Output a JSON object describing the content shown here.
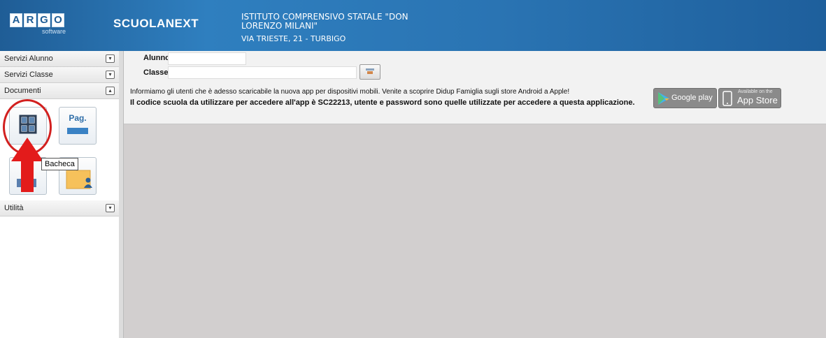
{
  "header": {
    "logo_letters": [
      "A",
      "R",
      "G",
      "O"
    ],
    "logo_subtitle": "software",
    "brand": "SCUOLANEXT",
    "school_name": "ISTITUTO COMPRENSIVO STATALE \"DON LORENZO MILANI\"",
    "school_address": "VIA TRIESTE, 21 - TURBIGO"
  },
  "sidebar": {
    "sections": [
      {
        "label": "Servizi Alunno",
        "toggle": "▾"
      },
      {
        "label": "Servizi Classe",
        "toggle": "▾"
      },
      {
        "label": "Documenti",
        "toggle": "▴"
      },
      {
        "label": "Utilità",
        "toggle": "▾"
      }
    ],
    "documenti_tiles": [
      {
        "name": "Bacheca",
        "icon": "grid-icon"
      },
      {
        "name": "Pag.",
        "icon": "pag-icon"
      },
      {
        "name": "",
        "icon": "doc-icon"
      },
      {
        "name": "",
        "icon": "folder-user-icon"
      }
    ],
    "tooltip": "Bacheca"
  },
  "form": {
    "alunno_label": "Alunno:",
    "alunno_value": "",
    "classe_label": "Classe:",
    "classe_value": ""
  },
  "info": {
    "line1": "Informiamo gli utenti che è adesso scaricabile la nuova app per dispositivi mobili. Venite a scoprire Didup Famiglia sugli store Android a Apple!",
    "line2": "Il codice scuola da utilizzare per accedere all'app è SC22213, utente e password sono quelle utilizzate per accedere a questa applicazione."
  },
  "stores": {
    "google_small": "",
    "google": "Google play",
    "apple_small": "Available on the",
    "apple": "App Store"
  },
  "colors": {
    "header_blue": "#2a74b3",
    "annotation_red": "#d2201f",
    "content_gray": "#d2cfcf"
  }
}
